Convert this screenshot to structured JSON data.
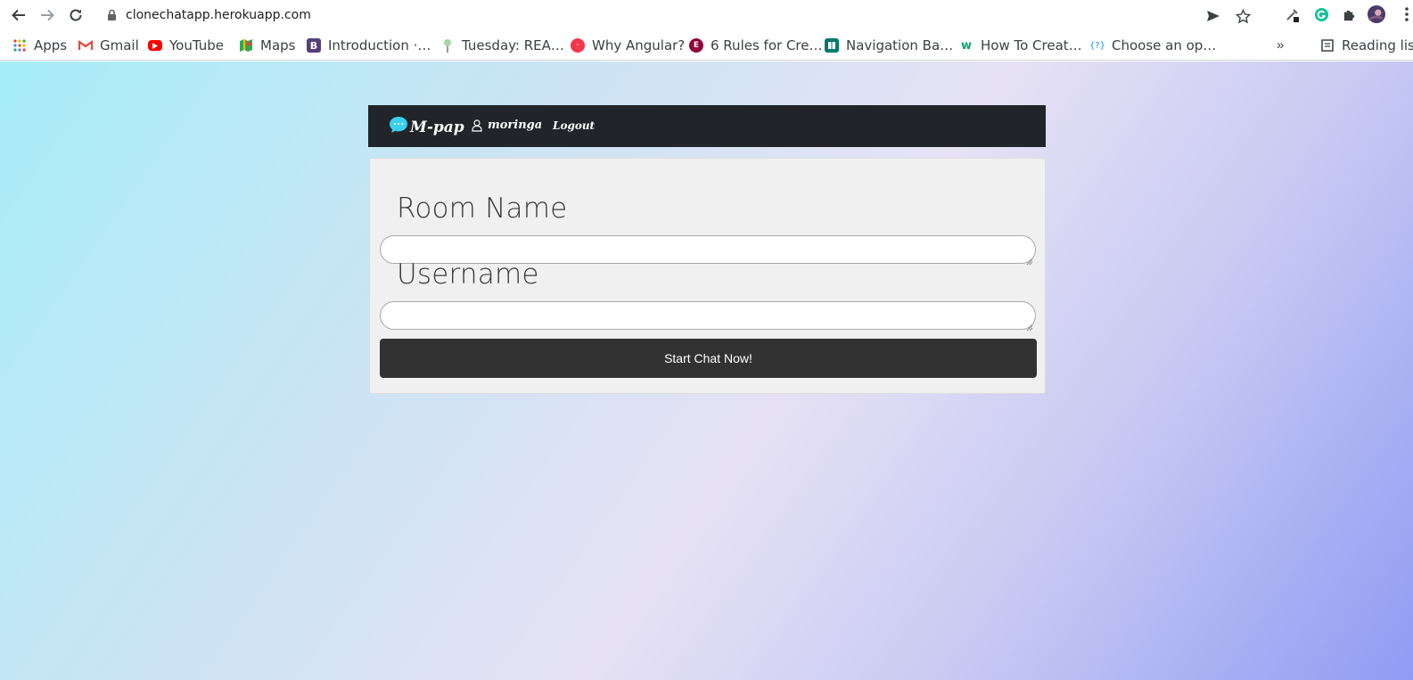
{
  "browser": {
    "url": "clonechatapp.herokuapp.com",
    "bookmarks": [
      {
        "label": "Apps",
        "icon": "apps-grid-icon"
      },
      {
        "label": "Gmail",
        "icon": "gmail-icon"
      },
      {
        "label": "YouTube",
        "icon": "youtube-icon"
      },
      {
        "label": "Maps",
        "icon": "maps-icon"
      },
      {
        "label": "Introduction ·…",
        "icon": "bootstrap-icon"
      },
      {
        "label": "Tuesday: REA…",
        "icon": "tree-icon"
      },
      {
        "label": "Why Angular?",
        "icon": "codelabs-icon"
      },
      {
        "label": "6 Rules for Cre…",
        "icon": "elementor-icon"
      },
      {
        "label": "Navigation Ba…",
        "icon": "book-icon"
      },
      {
        "label": "How To Creat…",
        "icon": "w3schools-icon"
      },
      {
        "label": "Choose an op…",
        "icon": "code-brackets-icon"
      }
    ],
    "reading_list": "Reading list"
  },
  "app": {
    "brand": "M-pap",
    "user": "moringa",
    "logout": "Logout"
  },
  "form": {
    "room_label": "Room Name",
    "room_value": "",
    "username_label": "Username",
    "username_value": "",
    "submit_label": "Start Chat Now!"
  },
  "colors": {
    "navbar": "#212529",
    "button": "#323232",
    "card": "#f0f0f0",
    "gradient_start": "#a6eef8",
    "gradient_end": "#8f9cf3"
  }
}
